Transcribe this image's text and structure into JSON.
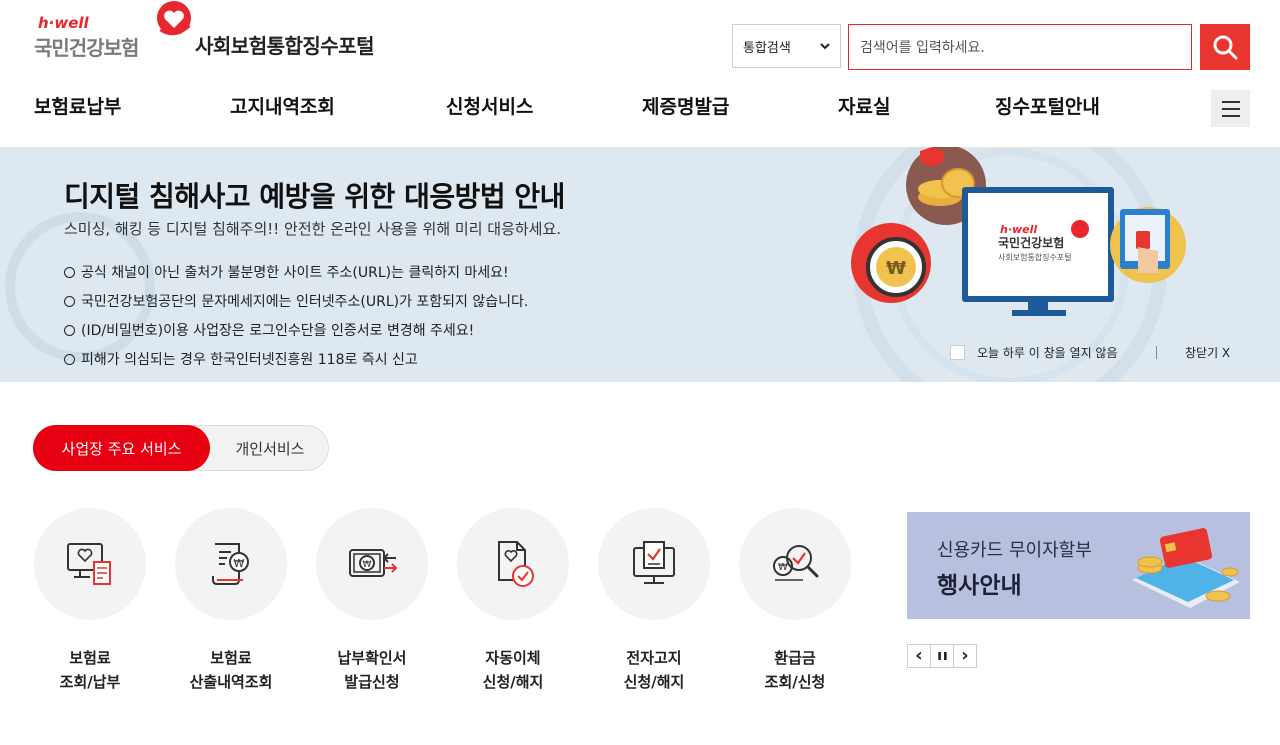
{
  "header": {
    "logo": {
      "brand_small": "h·well",
      "brand_name": "국민건강보험"
    },
    "portal_title": "사회보험통합징수포털",
    "search": {
      "scope_selected": "통합검색",
      "placeholder": "검색어를 입력하세요."
    },
    "gnb": [
      {
        "label": "보험료납부"
      },
      {
        "label": "고지내역조회"
      },
      {
        "label": "신청서비스"
      },
      {
        "label": "제증명발급"
      },
      {
        "label": "자료실"
      },
      {
        "label": "징수포털안내"
      }
    ]
  },
  "banner": {
    "title": "디지털 침해사고 예방을 위한 대응방법 안내",
    "subtitle": "스미싱, 해킹 등 디지털 침해주의!! 안전한 온라인 사용을 위해 미리 대응하세요.",
    "items": [
      "공식 채널이 아닌 출처가 불분명한 사이트 주소(URL)는 클릭하지 마세요!",
      "국민건강보험공단의 문자메세지에는 인터넷주소(URL)가 포함되지 않습니다.",
      "(ID/비밀번호)이용 사업장은 로그인수단을 인증서로 변경해 주세요!",
      "피해가 의심되는 경우 한국인터넷진흥원 118로 즉시 신고"
    ],
    "screen_brand_small": "h·well",
    "screen_brand_name": "국민건강보험",
    "screen_brand_sub": "사회보험통합징수포털",
    "no_show_today": "오늘 하루 이 창을 열지 않음",
    "close_label": "창닫기 X"
  },
  "tabs": [
    {
      "label": "사업장 주요 서비스",
      "active": true
    },
    {
      "label": "개인서비스",
      "active": false
    }
  ],
  "services": [
    {
      "icon": "monitor-heart-receipt-icon",
      "line1": "보험료",
      "line2": "조회/납부"
    },
    {
      "icon": "document-won-icon",
      "line1": "보험료",
      "line2": "산출내역조회"
    },
    {
      "icon": "won-card-arrows-icon",
      "line1": "납부확인서",
      "line2": "발급신청"
    },
    {
      "icon": "document-heart-check-icon",
      "line1": "자동이체",
      "line2": "신청/해지"
    },
    {
      "icon": "monitor-check-icon",
      "line1": "전자고지",
      "line2": "신청/해지"
    },
    {
      "icon": "won-magnifier-check-icon",
      "line1": "환급금",
      "line2": "조회/신청"
    }
  ],
  "promo": {
    "line1": "신용카드 무이자할부",
    "line2": "행사안내"
  },
  "carousel_controls": {
    "prev": "‹",
    "pause": "❚❚",
    "next": "›"
  },
  "colors": {
    "accent_red": "#e60012",
    "banner_bg": "#dde8f0",
    "promo_bg": "#b8c0e0"
  }
}
